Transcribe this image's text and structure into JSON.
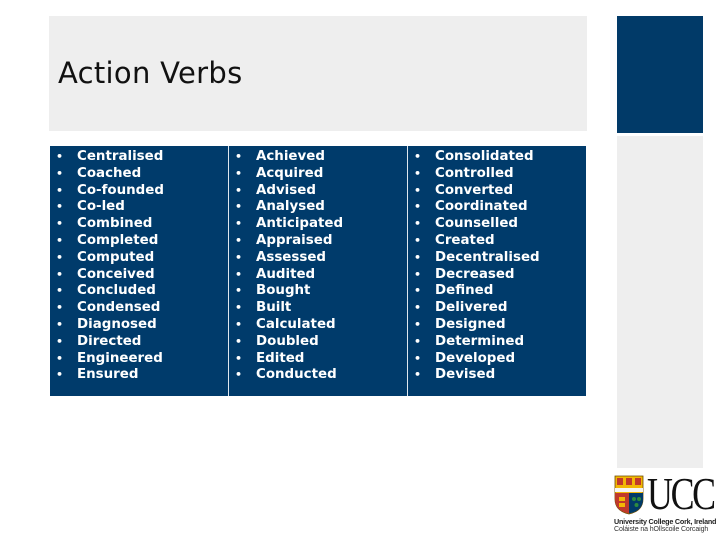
{
  "slide": {
    "title": "Action Verbs",
    "columns": [
      {
        "items": [
          "Centralised",
          "Coached",
          "Co-founded",
          "Co-led",
          "Combined",
          "Completed",
          "Computed",
          "Conceived",
          "Concluded",
          "Condensed",
          "Diagnosed",
          "Directed",
          "Engineered",
          "Ensured"
        ]
      },
      {
        "items": [
          "Achieved",
          "Acquired",
          "Advised",
          "Analysed",
          "Anticipated",
          "Appraised",
          "Assessed",
          "Audited",
          "Bought",
          "Built",
          "Calculated",
          "Doubled",
          "Edited",
          "Conducted"
        ]
      },
      {
        "items": [
          "Consolidated",
          "Controlled",
          "Converted",
          "Coordinated",
          "Counselled",
          "Created",
          "Decentralised",
          "Decreased",
          "Defined",
          "Delivered",
          "Designed",
          "Determined",
          "Developed",
          "Devised"
        ]
      }
    ],
    "bullet_glyph": "•"
  },
  "logo": {
    "wordmark": "UCC",
    "line1": "University College Cork, Ireland",
    "line2": "Coláiste na hOllscoile Corcaigh",
    "icon": "ucc-crest-icon"
  },
  "colors": {
    "accent": "#013a68",
    "panel_gray": "#eeeeee",
    "table_text": "#ffffff"
  }
}
